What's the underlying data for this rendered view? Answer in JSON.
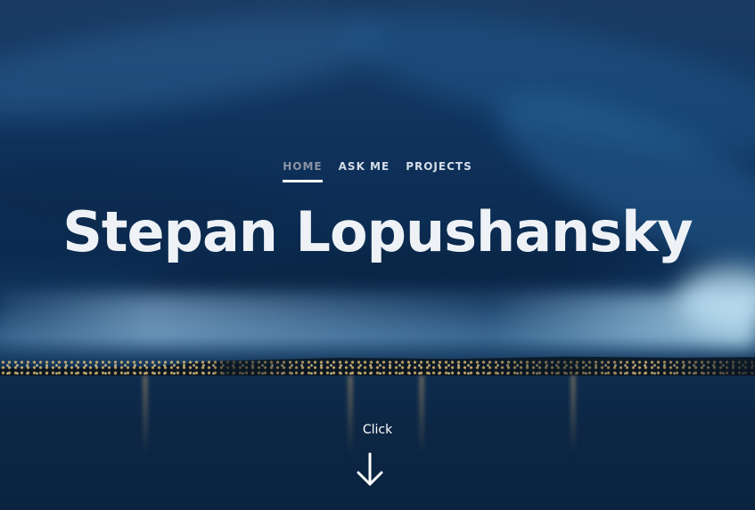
{
  "nav": {
    "items": [
      {
        "label": "HOME",
        "active": true
      },
      {
        "label": "ASK ME",
        "active": false
      },
      {
        "label": "PROJECTS",
        "active": false
      }
    ]
  },
  "hero": {
    "title": "Stepan Lopushansky",
    "background": "night city shoreline under dark blue clouds"
  },
  "cta": {
    "label": "Click",
    "icon": "arrow-down-icon"
  },
  "colors": {
    "title": "#eef2f6",
    "nav_text": "#d5dde8",
    "nav_active": "#8a94a2",
    "underline": "#ffffff"
  }
}
